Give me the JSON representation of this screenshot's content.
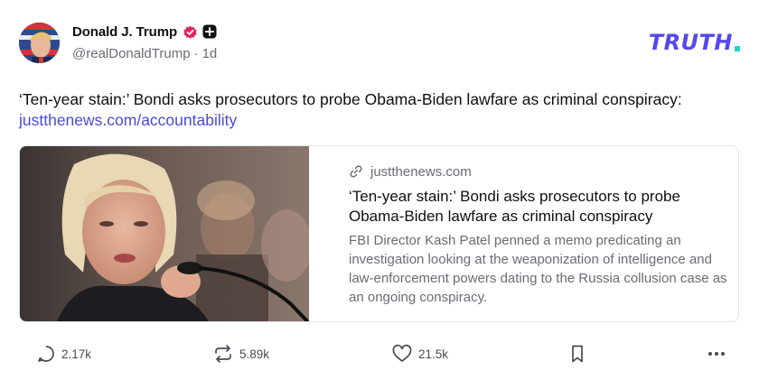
{
  "author": {
    "display_name": "Donald J. Trump",
    "handle": "@realDonaldTrump",
    "separator": "·",
    "time_ago": "1d",
    "verified_badge_color": "#e0245e"
  },
  "brand": {
    "logo_text": "TRUTH",
    "primary_color": "#5448ee",
    "accent_color": "#17d9c3"
  },
  "post": {
    "text": "‘Ten-year stain:’ Bondi asks prosecutors to probe Obama-Biden lawfare as criminal conspiracy:",
    "link": "justthenews.com/accountability"
  },
  "card": {
    "domain": "justthenews.com",
    "title": "‘Ten-year stain:’ Bondi asks prosecutors to probe Obama-Biden lawfare as criminal conspiracy",
    "description": "FBI Director Kash Patel penned a memo predicating an investigation looking at the weaponization of intelligence and law-enforcement powers dating to the Russia collusion case as an ongoing conspiracy.",
    "link_icon": "link-icon"
  },
  "actions": {
    "reply": {
      "icon": "reply-icon",
      "count": "2.17k"
    },
    "retruth": {
      "icon": "retruth-icon",
      "count": "5.89k"
    },
    "like": {
      "icon": "heart-icon",
      "count": "21.5k"
    },
    "bookmark": {
      "icon": "bookmark-icon"
    },
    "more": {
      "icon": "more-icon"
    }
  }
}
